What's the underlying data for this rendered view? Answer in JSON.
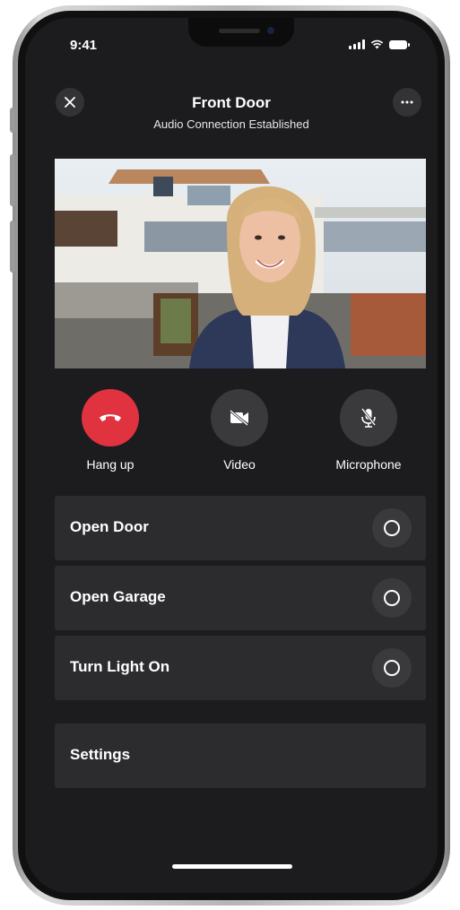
{
  "status_bar": {
    "time": "9:41"
  },
  "header": {
    "close_icon": "close-icon",
    "more_icon": "more-horizontal-icon",
    "title": "Front Door",
    "subtitle": "Audio Connection Established"
  },
  "video_feed": {
    "content": "doorbell-camera-view"
  },
  "call_actions": [
    {
      "label": "Hang up",
      "icon": "phone-hangup-icon",
      "color": "#e0333f"
    },
    {
      "label": "Video",
      "icon": "video-off-icon",
      "color": "#3a3a3c"
    },
    {
      "label": "Microphone",
      "icon": "microphone-off-icon",
      "color": "#3a3a3c"
    }
  ],
  "controls": [
    {
      "label": "Open Door"
    },
    {
      "label": "Open Garage"
    },
    {
      "label": "Turn Light On"
    }
  ],
  "settings": {
    "label": "Settings"
  },
  "colors": {
    "background": "#1c1c1e",
    "row": "#2c2c2e",
    "hangup": "#e0333f"
  }
}
